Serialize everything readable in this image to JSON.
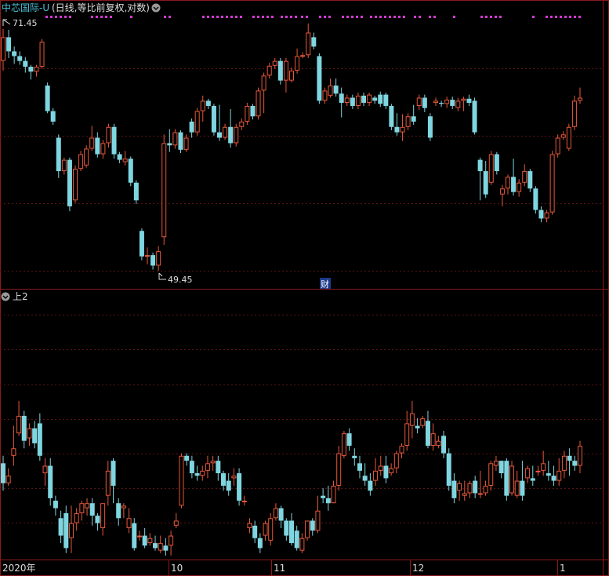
{
  "colors": {
    "background": "#000000",
    "up": "#e8583a",
    "down": "#7fd6e0",
    "frame": "#8a1a1a",
    "grid": "#5a1414",
    "title": "#49c2d6",
    "text": "#dddddd",
    "marker": "#d23ad2"
  },
  "header": {
    "stock_name": "中芯国际-U",
    "chart_params": "(日线,等比前复权,对数)",
    "toggle_icon": "chevron-down-icon"
  },
  "annotations": {
    "high_label": "71.45",
    "low_label": "49.45",
    "finance_marker": "财"
  },
  "lower_panel": {
    "title": "上2",
    "toggle_icon": "chevron-down-icon"
  },
  "x_axis": {
    "labels": [
      "2020年",
      "10",
      "11",
      "12",
      "1"
    ]
  },
  "chart_data": [
    {
      "type": "candlestick",
      "panel": "price",
      "scale": "log",
      "ylim": [
        49.0,
        72.5
      ],
      "marked_high": 71.45,
      "marked_low": 49.45,
      "candles": [
        [
          68.0,
          70.5,
          67.0,
          71.4
        ],
        [
          70.5,
          69.0,
          68.3,
          71.3
        ],
        [
          69.0,
          68.5,
          67.7,
          69.5
        ],
        [
          68.5,
          68.0,
          67.6,
          69.0
        ],
        [
          68.0,
          67.4,
          66.8,
          68.4
        ],
        [
          67.4,
          66.9,
          66.1,
          67.6
        ],
        [
          66.9,
          67.4,
          66.4,
          67.6
        ],
        [
          67.4,
          70.0,
          67.2,
          70.3
        ],
        [
          65.5,
          63.0,
          62.8,
          65.8
        ],
        [
          63.0,
          62.0,
          61.7,
          63.3
        ],
        [
          60.5,
          57.5,
          56.9,
          60.8
        ],
        [
          57.5,
          58.5,
          57.2,
          58.7
        ],
        [
          58.5,
          54.5,
          54.1,
          58.7
        ],
        [
          55.0,
          57.7,
          54.8,
          58.0
        ],
        [
          57.7,
          59.0,
          57.5,
          59.3
        ],
        [
          58.0,
          59.5,
          57.8,
          59.8
        ],
        [
          59.5,
          60.5,
          59.3,
          61.6
        ],
        [
          60.5,
          59.0,
          58.7,
          61.0
        ],
        [
          59.0,
          60.0,
          58.6,
          60.3
        ],
        [
          60.0,
          61.5,
          59.6,
          61.8
        ],
        [
          61.5,
          59.0,
          58.6,
          61.8
        ],
        [
          59.0,
          58.5,
          58.2,
          59.2
        ],
        [
          58.3,
          58.6,
          58.0,
          59.3
        ],
        [
          58.6,
          56.5,
          56.2,
          58.8
        ],
        [
          56.5,
          55.0,
          54.7,
          56.7
        ],
        [
          52.5,
          50.5,
          50.2,
          52.7
        ],
        [
          50.5,
          50.6,
          49.9,
          51.2
        ],
        [
          50.6,
          49.8,
          49.5,
          50.8
        ],
        [
          49.8,
          50.9,
          49.4,
          51.3
        ],
        [
          52.0,
          60.0,
          51.4,
          60.8
        ],
        [
          60.0,
          59.8,
          59.2,
          61.3
        ],
        [
          59.8,
          61.0,
          59.5,
          61.3
        ],
        [
          61.0,
          59.4,
          59.1,
          61.2
        ],
        [
          59.4,
          60.5,
          59.2,
          60.8
        ],
        [
          62.0,
          61.0,
          60.5,
          62.3
        ],
        [
          61.0,
          63.0,
          60.7,
          63.3
        ],
        [
          63.0,
          64.0,
          62.0,
          64.5
        ],
        [
          64.0,
          63.5,
          63.2,
          64.2
        ],
        [
          63.5,
          61.0,
          60.7,
          63.7
        ],
        [
          61.0,
          60.5,
          60.2,
          63.6
        ],
        [
          60.5,
          61.5,
          60.3,
          61.8
        ],
        [
          61.5,
          60.0,
          59.6,
          63.2
        ],
        [
          60.0,
          61.5,
          59.7,
          61.8
        ],
        [
          61.5,
          62.0,
          61.2,
          62.3
        ],
        [
          62.0,
          63.5,
          61.7,
          63.8
        ],
        [
          63.5,
          62.5,
          62.2,
          63.7
        ],
        [
          62.5,
          65.0,
          62.2,
          65.3
        ],
        [
          65.0,
          66.5,
          62.8,
          66.8
        ],
        [
          66.5,
          67.5,
          66.2,
          67.8
        ],
        [
          67.5,
          68.0,
          67.2,
          68.3
        ],
        [
          68.0,
          66.0,
          65.6,
          68.3
        ],
        [
          66.0,
          68.0,
          64.8,
          68.3
        ],
        [
          66.0,
          67.0,
          65.8,
          67.3
        ],
        [
          67.0,
          68.5,
          66.7,
          69.3
        ],
        [
          68.5,
          68.6,
          68.3,
          68.9
        ],
        [
          68.6,
          71.0,
          68.3,
          72.0
        ],
        [
          70.5,
          69.5,
          69.2,
          71.0
        ],
        [
          68.5,
          64.0,
          63.7,
          68.8
        ],
        [
          64.0,
          65.0,
          63.7,
          65.3
        ],
        [
          64.5,
          65.5,
          64.3,
          66.2
        ],
        [
          65.5,
          64.7,
          64.4,
          66.2
        ],
        [
          64.7,
          63.8,
          62.4,
          65.3
        ],
        [
          63.8,
          64.3,
          63.5,
          64.6
        ],
        [
          64.3,
          63.5,
          63.2,
          64.6
        ],
        [
          63.5,
          64.5,
          63.2,
          64.8
        ],
        [
          64.5,
          63.8,
          63.5,
          64.8
        ],
        [
          63.8,
          64.6,
          63.5,
          64.8
        ],
        [
          64.3,
          64.0,
          63.7,
          64.5
        ],
        [
          64.6,
          63.7,
          63.4,
          64.9
        ],
        [
          64.6,
          63.5,
          63.2,
          64.8
        ],
        [
          63.5,
          61.5,
          61.2,
          63.7
        ],
        [
          61.5,
          61.0,
          60.7,
          62.8
        ],
        [
          61.0,
          61.5,
          60.2,
          62.7
        ],
        [
          61.5,
          62.5,
          61.2,
          62.8
        ],
        [
          62.5,
          62.0,
          61.7,
          63.6
        ],
        [
          63.5,
          64.3,
          63.1,
          64.6
        ],
        [
          64.3,
          63.3,
          62.9,
          64.6
        ],
        [
          62.5,
          60.5,
          60.2,
          62.8
        ],
        [
          63.8,
          64.0,
          63.5,
          64.3
        ],
        [
          63.8,
          63.7,
          63.4,
          64.0
        ],
        [
          63.7,
          64.1,
          63.3,
          64.4
        ],
        [
          64.1,
          63.5,
          63.2,
          64.4
        ],
        [
          63.3,
          64.0,
          63.0,
          64.3
        ],
        [
          64.0,
          64.2,
          63.0,
          64.4
        ],
        [
          64.2,
          63.8,
          63.5,
          64.6
        ],
        [
          64.0,
          61.0,
          60.8,
          64.3
        ],
        [
          58.5,
          57.5,
          55.0,
          58.7
        ],
        [
          57.5,
          55.5,
          55.2,
          58.4
        ],
        [
          56.5,
          59.0,
          56.3,
          59.3
        ],
        [
          59.0,
          57.5,
          57.2,
          59.2
        ],
        [
          55.5,
          56.0,
          54.5,
          56.3
        ],
        [
          56.0,
          57.0,
          55.5,
          57.2
        ],
        [
          57.0,
          55.7,
          55.4,
          58.6
        ],
        [
          55.7,
          56.5,
          55.3,
          56.8
        ],
        [
          56.5,
          57.5,
          56.2,
          58.1
        ],
        [
          57.5,
          56.0,
          55.7,
          57.7
        ],
        [
          56.0,
          54.2,
          53.9,
          56.2
        ],
        [
          54.2,
          53.5,
          53.2,
          54.5
        ],
        [
          53.5,
          54.0,
          53.2,
          54.2
        ],
        [
          54.0,
          59.0,
          53.8,
          59.3
        ],
        [
          59.0,
          60.5,
          58.7,
          60.8
        ],
        [
          60.5,
          60.8,
          60.3,
          61.1
        ],
        [
          59.5,
          61.5,
          59.3,
          61.8
        ],
        [
          61.5,
          64.0,
          61.2,
          64.5
        ],
        [
          64.0,
          64.3,
          63.7,
          65.3
        ]
      ]
    },
    {
      "type": "candlestick",
      "panel": "indicator",
      "title": "上2",
      "ylim": [
        0,
        1
      ],
      "candles": [
        [
          0.37,
          0.29,
          0.26,
          0.4
        ],
        [
          0.29,
          0.32,
          0.28,
          0.35
        ],
        [
          0.4,
          0.43,
          0.36,
          0.52
        ],
        [
          0.49,
          0.56,
          0.48,
          0.62
        ],
        [
          0.56,
          0.46,
          0.43,
          0.58
        ],
        [
          0.47,
          0.51,
          0.44,
          0.53
        ],
        [
          0.51,
          0.45,
          0.43,
          0.54
        ],
        [
          0.53,
          0.4,
          0.38,
          0.57
        ],
        [
          0.33,
          0.36,
          0.28,
          0.39
        ],
        [
          0.36,
          0.23,
          0.2,
          0.39
        ],
        [
          0.22,
          0.19,
          0.16,
          0.24
        ],
        [
          0.15,
          0.08,
          0.05,
          0.18
        ],
        [
          0.17,
          0.03,
          0.01,
          0.2
        ],
        [
          0.07,
          0.13,
          0.01,
          0.2
        ],
        [
          0.13,
          0.17,
          0.1,
          0.19
        ],
        [
          0.17,
          0.21,
          0.14,
          0.22
        ],
        [
          0.19,
          0.21,
          0.16,
          0.23
        ],
        [
          0.21,
          0.16,
          0.12,
          0.23
        ],
        [
          0.16,
          0.13,
          0.1,
          0.17
        ],
        [
          0.11,
          0.21,
          0.08,
          0.21
        ],
        [
          0.24,
          0.34,
          0.2,
          0.38
        ],
        [
          0.38,
          0.28,
          0.21,
          0.39
        ],
        [
          0.21,
          0.15,
          0.12,
          0.23
        ],
        [
          0.19,
          0.2,
          0.15,
          0.21
        ],
        [
          0.11,
          0.15,
          0.09,
          0.19
        ],
        [
          0.13,
          0.03,
          0.02,
          0.15
        ],
        [
          0.08,
          0.08,
          0.06,
          0.1
        ],
        [
          0.08,
          0.04,
          0.03,
          0.11
        ],
        [
          0.05,
          0.07,
          0.04,
          0.09
        ],
        [
          0.05,
          0.03,
          0.02,
          0.08
        ],
        [
          0.02,
          0.05,
          0.01,
          0.08
        ],
        [
          0.04,
          0.02,
          0.0,
          0.07
        ],
        [
          0.04,
          0.08,
          0.0,
          0.1
        ],
        [
          0.12,
          0.14,
          0.11,
          0.17
        ],
        [
          0.2,
          0.4,
          0.19,
          0.41
        ],
        [
          0.4,
          0.38,
          0.36,
          0.41
        ],
        [
          0.38,
          0.33,
          0.31,
          0.4
        ],
        [
          0.33,
          0.32,
          0.3,
          0.36
        ],
        [
          0.32,
          0.34,
          0.3,
          0.36
        ],
        [
          0.34,
          0.37,
          0.31,
          0.4
        ],
        [
          0.37,
          0.38,
          0.34,
          0.4
        ],
        [
          0.38,
          0.33,
          0.3,
          0.4
        ],
        [
          0.33,
          0.28,
          0.26,
          0.34
        ],
        [
          0.3,
          0.26,
          0.24,
          0.33
        ],
        [
          0.31,
          0.32,
          0.28,
          0.35
        ],
        [
          0.33,
          0.22,
          0.2,
          0.35
        ],
        [
          0.22,
          0.22,
          0.2,
          0.24
        ],
        [
          0.11,
          0.13,
          0.09,
          0.15
        ],
        [
          0.12,
          0.07,
          0.05,
          0.14
        ],
        [
          0.07,
          0.03,
          0.01,
          0.09
        ],
        [
          0.08,
          0.13,
          0.06,
          0.14
        ],
        [
          0.06,
          0.15,
          0.04,
          0.17
        ],
        [
          0.15,
          0.19,
          0.14,
          0.21
        ],
        [
          0.19,
          0.14,
          0.11,
          0.2
        ],
        [
          0.14,
          0.08,
          0.06,
          0.15
        ],
        [
          0.14,
          0.05,
          0.04,
          0.17
        ],
        [
          0.1,
          0.03,
          0.02,
          0.12
        ],
        [
          0.02,
          0.07,
          0.01,
          0.09
        ],
        [
          0.07,
          0.14,
          0.06,
          0.14
        ],
        [
          0.14,
          0.1,
          0.08,
          0.15
        ],
        [
          0.1,
          0.18,
          0.09,
          0.24
        ],
        [
          0.24,
          0.23,
          0.21,
          0.27
        ],
        [
          0.23,
          0.21,
          0.18,
          0.28
        ],
        [
          0.21,
          0.28,
          0.21,
          0.3
        ],
        [
          0.28,
          0.41,
          0.26,
          0.44
        ],
        [
          0.4,
          0.49,
          0.39,
          0.5
        ],
        [
          0.49,
          0.44,
          0.42,
          0.51
        ],
        [
          0.4,
          0.39,
          0.36,
          0.43
        ],
        [
          0.37,
          0.34,
          0.31,
          0.4
        ],
        [
          0.32,
          0.3,
          0.28,
          0.37
        ],
        [
          0.3,
          0.26,
          0.24,
          0.33
        ],
        [
          0.3,
          0.34,
          0.28,
          0.39
        ],
        [
          0.34,
          0.36,
          0.32,
          0.4
        ],
        [
          0.36,
          0.31,
          0.29,
          0.4
        ],
        [
          0.33,
          0.35,
          0.32,
          0.37
        ],
        [
          0.35,
          0.41,
          0.33,
          0.42
        ],
        [
          0.41,
          0.44,
          0.39,
          0.45
        ],
        [
          0.44,
          0.53,
          0.42,
          0.58
        ],
        [
          0.52,
          0.57,
          0.47,
          0.62
        ],
        [
          0.52,
          0.51,
          0.49,
          0.55
        ],
        [
          0.52,
          0.55,
          0.51,
          0.56
        ],
        [
          0.54,
          0.44,
          0.43,
          0.58
        ],
        [
          0.44,
          0.49,
          0.42,
          0.53
        ],
        [
          0.44,
          0.46,
          0.43,
          0.48
        ],
        [
          0.48,
          0.41,
          0.39,
          0.5
        ],
        [
          0.41,
          0.28,
          0.26,
          0.43
        ],
        [
          0.3,
          0.23,
          0.21,
          0.33
        ],
        [
          0.26,
          0.29,
          0.22,
          0.3
        ],
        [
          0.24,
          0.25,
          0.22,
          0.3
        ],
        [
          0.25,
          0.29,
          0.23,
          0.3
        ],
        [
          0.3,
          0.25,
          0.23,
          0.32
        ],
        [
          0.25,
          0.25,
          0.23,
          0.34
        ],
        [
          0.25,
          0.28,
          0.24,
          0.3
        ],
        [
          0.28,
          0.37,
          0.26,
          0.38
        ],
        [
          0.36,
          0.38,
          0.34,
          0.4
        ],
        [
          0.38,
          0.33,
          0.31,
          0.38
        ],
        [
          0.38,
          0.24,
          0.22,
          0.39
        ],
        [
          0.25,
          0.36,
          0.24,
          0.38
        ],
        [
          0.24,
          0.3,
          0.23,
          0.34
        ],
        [
          0.3,
          0.24,
          0.22,
          0.38
        ],
        [
          0.31,
          0.35,
          0.29,
          0.36
        ],
        [
          0.31,
          0.3,
          0.28,
          0.36
        ],
        [
          0.34,
          0.34,
          0.32,
          0.36
        ],
        [
          0.34,
          0.37,
          0.32,
          0.42
        ],
        [
          0.33,
          0.32,
          0.3,
          0.38
        ],
        [
          0.32,
          0.3,
          0.28,
          0.36
        ],
        [
          0.3,
          0.34,
          0.28,
          0.39
        ],
        [
          0.34,
          0.4,
          0.31,
          0.42
        ],
        [
          0.4,
          0.38,
          0.32,
          0.43
        ],
        [
          0.38,
          0.36,
          0.34,
          0.4
        ],
        [
          0.36,
          0.44,
          0.33,
          0.46
        ]
      ]
    }
  ]
}
